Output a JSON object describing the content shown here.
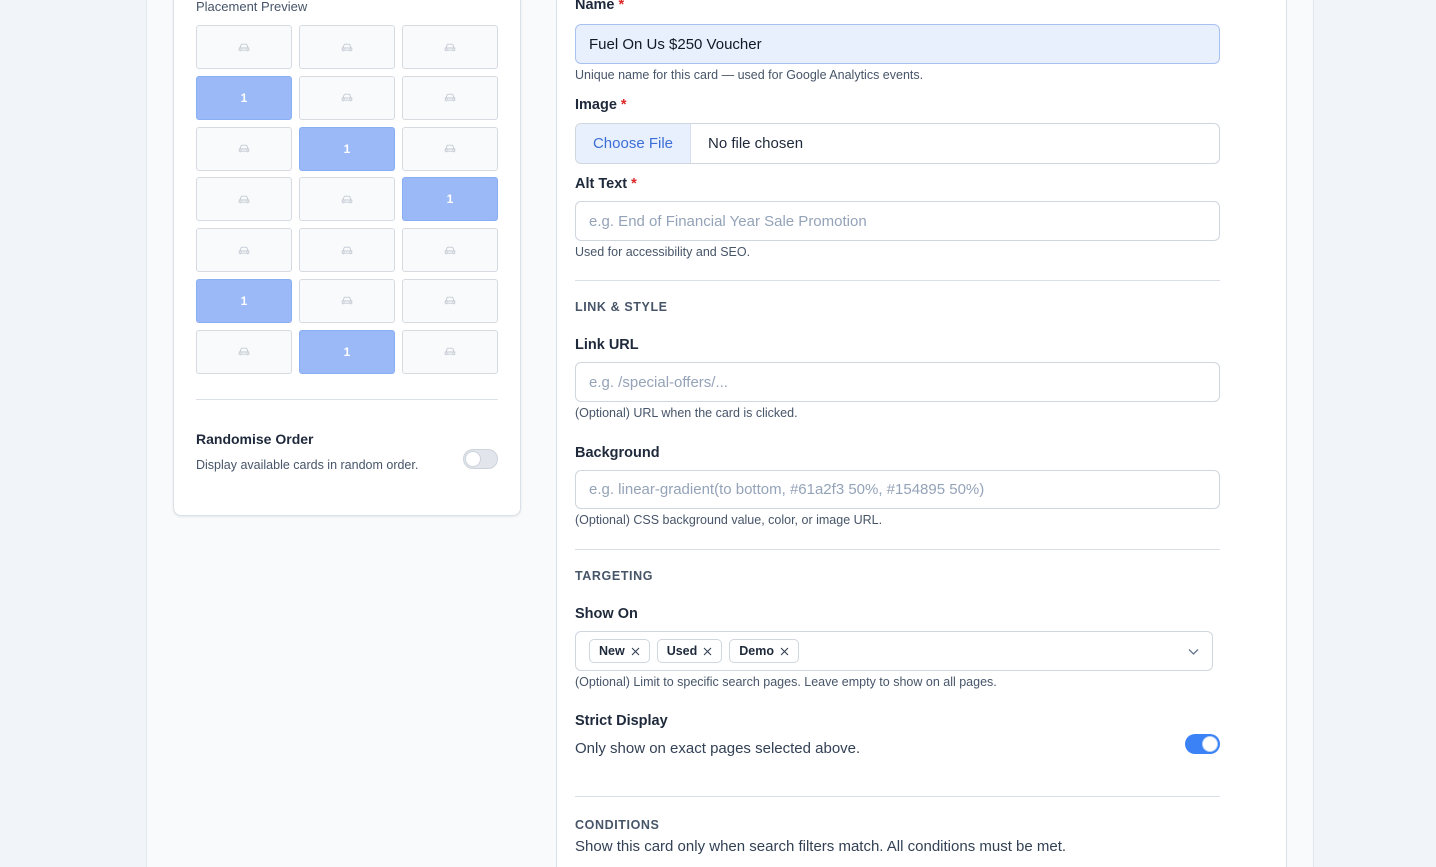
{
  "placement": {
    "label": "Placement Preview",
    "cells": [
      {
        "active": false,
        "value": ""
      },
      {
        "active": false,
        "value": ""
      },
      {
        "active": false,
        "value": ""
      },
      {
        "active": true,
        "value": "1"
      },
      {
        "active": false,
        "value": ""
      },
      {
        "active": false,
        "value": ""
      },
      {
        "active": false,
        "value": ""
      },
      {
        "active": true,
        "value": "1"
      },
      {
        "active": false,
        "value": ""
      },
      {
        "active": false,
        "value": ""
      },
      {
        "active": false,
        "value": ""
      },
      {
        "active": true,
        "value": "1"
      },
      {
        "active": false,
        "value": ""
      },
      {
        "active": false,
        "value": ""
      },
      {
        "active": false,
        "value": ""
      },
      {
        "active": true,
        "value": "1"
      },
      {
        "active": false,
        "value": ""
      },
      {
        "active": false,
        "value": ""
      },
      {
        "active": false,
        "value": ""
      },
      {
        "active": true,
        "value": "1"
      },
      {
        "active": false,
        "value": ""
      }
    ]
  },
  "randomise": {
    "title": "Randomise Order",
    "description": "Display available cards in random order.",
    "enabled": false
  },
  "form": {
    "name": {
      "label": "Name",
      "required": "*",
      "value": "Fuel On Us $250 Voucher",
      "help": "Unique name for this card — used for Google Analytics events."
    },
    "image": {
      "label": "Image",
      "required": "*",
      "button": "Choose File",
      "status": "No file chosen"
    },
    "alt": {
      "label": "Alt Text",
      "required": "*",
      "placeholder": "e.g. End of Financial Year Sale Promotion",
      "help": "Used for accessibility and SEO."
    },
    "link_style_section": "LINK & STYLE",
    "link": {
      "label": "Link URL",
      "placeholder": "e.g. /special-offers/...",
      "help": "(Optional) URL when the card is clicked."
    },
    "background": {
      "label": "Background",
      "placeholder": "e.g. linear-gradient(to bottom, #61a2f3 50%, #154895 50%)",
      "help": "(Optional) CSS background value, color, or image URL."
    },
    "targeting_section": "TARGETING",
    "show_on": {
      "label": "Show On",
      "chips": [
        "New",
        "Used",
        "Demo"
      ],
      "help": "(Optional) Limit to specific search pages. Leave empty to show on all pages."
    },
    "strict": {
      "label": "Strict Display",
      "description": "Only show on exact pages selected above.",
      "enabled": true
    },
    "conditions_section": "CONDITIONS",
    "conditions_help": "Show this card only when search filters match. All conditions must be met."
  },
  "colors": {
    "accent": "#3b82f6",
    "active_cell": "#9bb9f7",
    "required": "#dc2626"
  }
}
